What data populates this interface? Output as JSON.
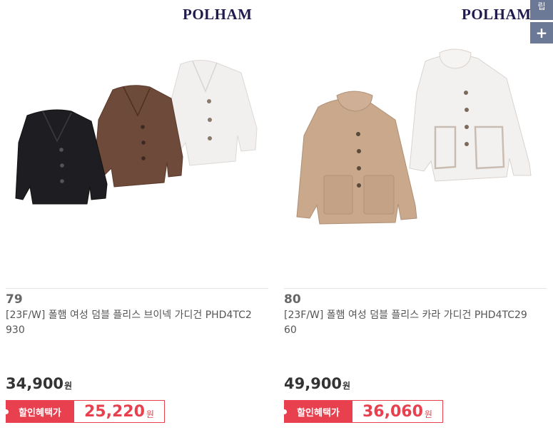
{
  "side": {
    "top_label": "립",
    "plus_label": "+"
  },
  "products": [
    {
      "brand": "POLHAM",
      "rank": "79",
      "title": "[23F/W] 폴햄 여성 덤블 플리스 브이넥 가디건 PHD4TC2930",
      "price": "34,900",
      "won": "원",
      "sale_label": "할인혜택가",
      "sale_price": "25,220",
      "sale_won": "원",
      "colors": {
        "sale": "#e8404e",
        "brand": "#1f1a4d"
      }
    },
    {
      "brand": "POLHAM",
      "rank": "80",
      "title": "[23F/W] 폴햄 여성 덤블 플리스 카라 가디건 PHD4TC2960",
      "price": "49,900",
      "won": "원",
      "sale_label": "할인혜택가",
      "sale_price": "36,060",
      "sale_won": "원",
      "colors": {
        "sale": "#e8404e",
        "brand": "#1f1a4d"
      }
    }
  ]
}
